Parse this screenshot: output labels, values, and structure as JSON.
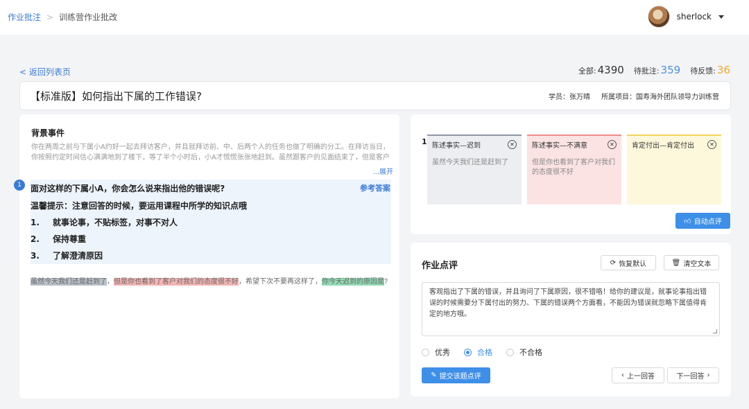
{
  "breadcrumb": {
    "root": "作业批注",
    "sep": ">",
    "current": "训练营作业批改"
  },
  "user": {
    "name": "sherlock"
  },
  "back_label": "< 返回列表页",
  "stats": {
    "all_label": "全部:",
    "all_value": "4390",
    "pending_label": "待批注:",
    "pending_value": "359",
    "feedback_label": "待反馈:",
    "feedback_value": "36"
  },
  "assignment": {
    "title": "【标准版】如何指出下属的工作错误?",
    "student": "学员：张万晴",
    "project": "所属项目：国寿海外团队领导力训练营"
  },
  "background": {
    "title": "背景事件",
    "text": "你在两周之前与下属小A约好一起去拜访客户，并且就拜访前、中、后两个人的任务也做了明确的分工。在拜访当日，你按照约定时间信心满满地到了楼下，等了半个小时后，小A才慌慌张张地赶到。虽然跟客户的见面结束了，但是客户对你",
    "expand": "...展开"
  },
  "question": {
    "number": "1",
    "title": "面对这样的下属小A，你会怎么说来指出他的错误呢?",
    "ref_label": "参考答案",
    "tip": "温馨提示：注意回答的时候，要运用课程中所学的知识点哦",
    "points": [
      {
        "n": "1.",
        "text": "就事论事，不贴标签，对事不对人"
      },
      {
        "n": "2.",
        "text": "保持尊重"
      },
      {
        "n": "3.",
        "text": "了解澄清原因"
      }
    ]
  },
  "answer": {
    "seg1": "虽然今天我们还是赶到了",
    "sep1": "，",
    "seg2": "但是你也看到了客户对我们的态度很不好",
    "sep2": "，希望下次不要再这样了，",
    "seg3": "你今天迟到的原因是",
    "end": "?"
  },
  "annotation": {
    "number": "1.",
    "cards": [
      {
        "title": "陈述事实—迟到",
        "body": "虽然今天我们还是赶到了"
      },
      {
        "title": "陈述事实—不满意",
        "body": "但是你也看到了客户对我们的态度很不好"
      },
      {
        "title": "肯定付出—肯定付出",
        "body": ""
      }
    ],
    "auto_label": "自动点评"
  },
  "review": {
    "title": "作业点评",
    "reset_label": "恢复默认",
    "clear_label": "清空文本",
    "text": "客观指出了下属的错误，并且询问了下属原因，很不错咯！给你的建议是，就事论事指出错误的时候需要分下属付出的努力、下属的错误两个方面看，不能因为错误就忽略下属值得肯定的地方哦。",
    "grades": [
      "优秀",
      "合格",
      "不合格"
    ],
    "selected": "合格",
    "submit_label": "提交该题点评",
    "prev_label": "上一回答",
    "next_label": "下一回答"
  },
  "colors": {
    "accent": "#3e8fe8",
    "pending": "#4a90e2",
    "feedback": "#f5a623"
  }
}
